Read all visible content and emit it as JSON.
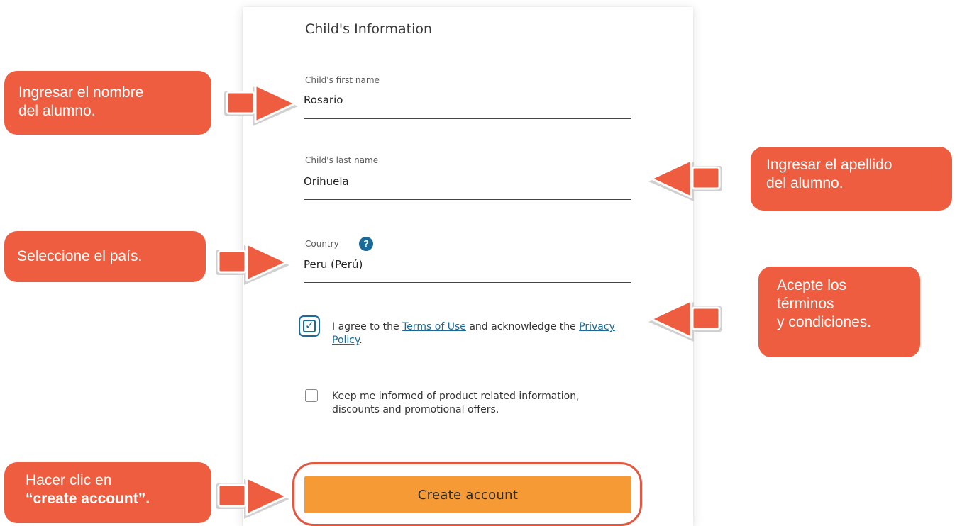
{
  "form": {
    "section_title": "Child's Information",
    "first_name": {
      "label": "Child's first name",
      "value": "Rosario"
    },
    "last_name": {
      "label": "Child's last name",
      "value": "Orihuela"
    },
    "country": {
      "label": "Country",
      "value": "Peru (Perú)",
      "help_symbol": "?"
    },
    "terms": {
      "checked": true,
      "text_before": "I agree to the ",
      "terms_link": "Terms of Use",
      "text_middle": " and acknowledge the ",
      "privacy_link": "Privacy Policy",
      "text_after": "."
    },
    "marketing": {
      "checked": false,
      "text": "Keep me informed of product related information, discounts and promotional offers."
    },
    "create_button": "Create account"
  },
  "callouts": {
    "first_name": {
      "line1": "Ingresar el nombre",
      "line2": "del alumno."
    },
    "last_name": {
      "line1": "Ingresar el apellido",
      "line2": "del alumno."
    },
    "country": {
      "line1": "Seleccione el país."
    },
    "terms": {
      "line1": "Acepte los",
      "line2": "términos",
      "line3": "y condiciones."
    },
    "create": {
      "line1": "Hacer clic en",
      "line2": "“create account”."
    }
  },
  "colors": {
    "callout": "#ee5d3f",
    "button": "#f59a35",
    "link": "#1a6a9a"
  }
}
